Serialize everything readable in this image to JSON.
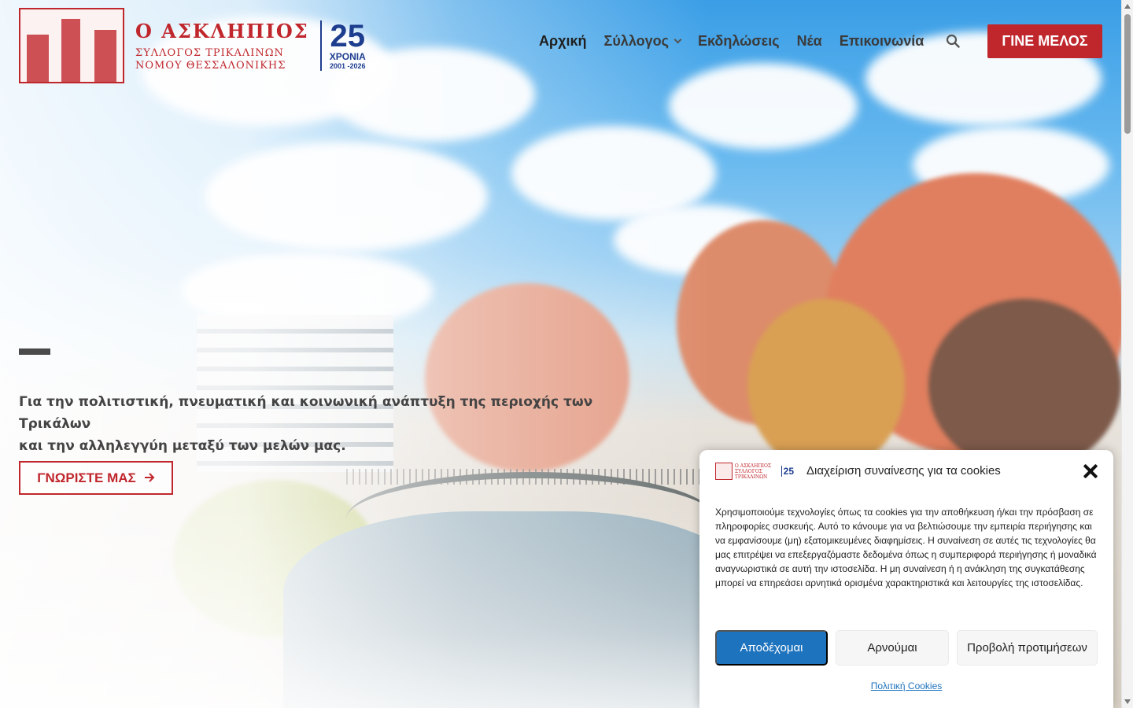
{
  "header": {
    "logo": {
      "title": "Ο ΑΣΚΛΗΠΙΟΣ",
      "subtitle_line1": "ΣΥΛΛΟΓΟΣ ΤΡΙΚΑΛΙΝΩΝ",
      "subtitle_line2": "ΝΟΜΟΥ ΘΕΣΣΑΛΟΝΙΚΗΣ",
      "anniversary_number": "25",
      "anniversary_label": "ΧΡΟΝΙΑ",
      "anniversary_years": "2001 -2026"
    },
    "nav": [
      {
        "label": "Αρχική",
        "active": true
      },
      {
        "label": "Σύλλογος",
        "has_dropdown": true
      },
      {
        "label": "Εκδηλώσεις"
      },
      {
        "label": "Νέα"
      },
      {
        "label": "Επικοινωνία"
      }
    ],
    "search_icon": "search-icon",
    "cta_label": "ΓΙΝΕ ΜΕΛΟΣ"
  },
  "hero": {
    "tagline_line1": "Για την πολιτιστική, πνευματική και κοινωνική ανάπτυξη της περιοχής των Τρικάλων",
    "tagline_line2": "και την αλληλεγγύη μεταξύ των μελών μας.",
    "button_label": "ΓΝΩΡΙΣΤΕ ΜΑΣ",
    "button_icon": "arrow-right-icon"
  },
  "cookie_banner": {
    "title": "Διαχείριση συναίνεσης για τα cookies",
    "body": "Χρησιμοποιούμε τεχνολογίες όπως τα cookies για την αποθήκευση ή/και την πρόσβαση σε πληροφορίες συσκευής. Αυτό το κάνουμε για να βελτιώσουμε την εμπειρία περιήγησης και να εμφανίσουμε (μη) εξατομικευμένες διαφημίσεις. Η συναίνεση σε αυτές τις τεχνολογίες θα μας επιτρέψει να επεξεργαζόμαστε δεδομένα όπως η συμπεριφορά περιήγησης ή μοναδικά αναγνωριστικά σε αυτή την ιστοσελίδα. Η μη συναίνεση ή η ανάκληση της συγκατάθεσης μπορεί να επηρεάσει αρνητικά ορισμένα χαρακτηριστικά και λειτουργίες της ιστοσελίδας.",
    "accept_label": "Αποδέχομαι",
    "deny_label": "Αρνούμαι",
    "preferences_label": "Προβολή προτιμήσεων",
    "policy_link": "Πολιτική Cookies",
    "logo_number": "25"
  },
  "colors": {
    "brand_red": "#c0272d",
    "brand_blue": "#1d3d8f",
    "accept_blue": "#1e73be"
  }
}
